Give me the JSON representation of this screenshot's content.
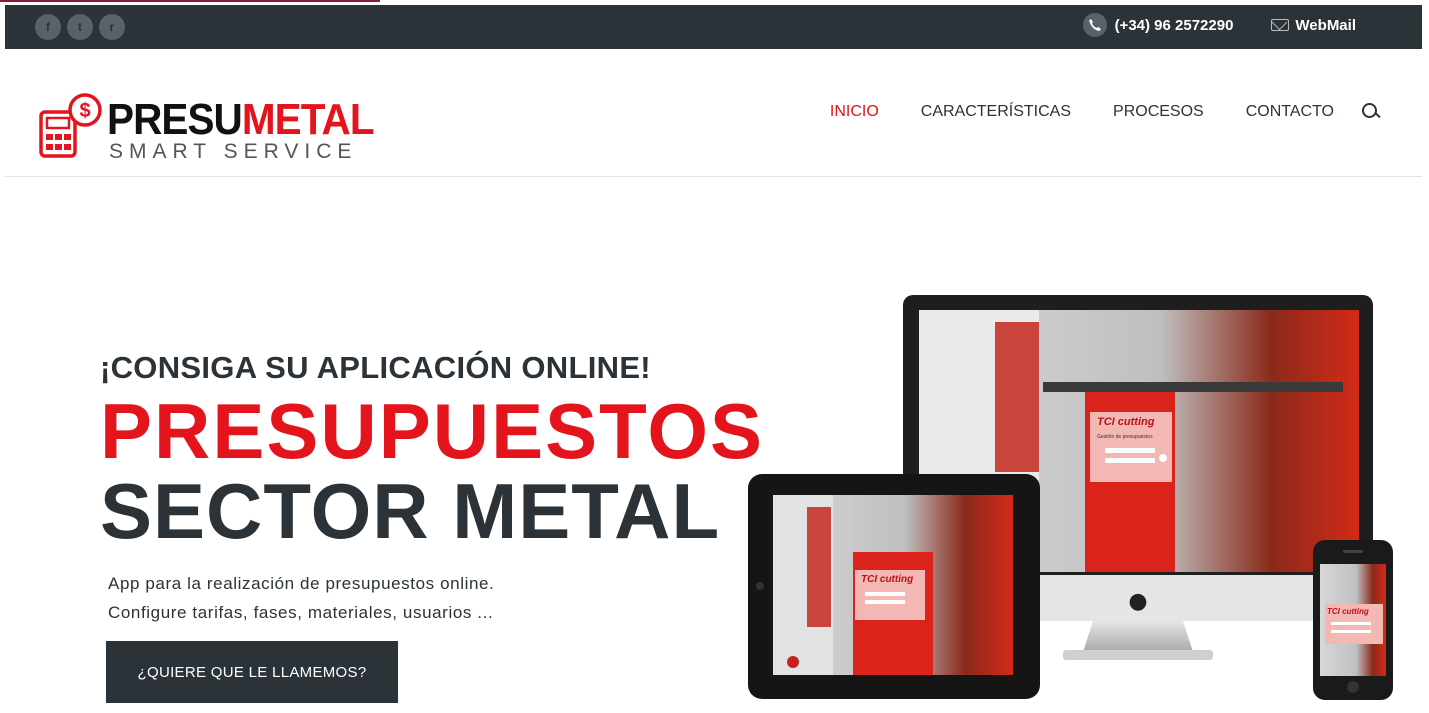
{
  "topbar": {
    "social": [
      {
        "icon": "facebook-icon",
        "glyph": "f"
      },
      {
        "icon": "twitter-icon",
        "glyph": "t"
      },
      {
        "icon": "rss-icon",
        "glyph": "r"
      }
    ],
    "phone": "(+34) 96 2572290",
    "webmail": "WebMail"
  },
  "logo": {
    "word_dark": "PRESU",
    "word_red": "METAL",
    "subtitle": "SMART SERVICE"
  },
  "nav": {
    "items": [
      {
        "label": "INICIO",
        "active": true
      },
      {
        "label": "CARACTERÍSTICAS",
        "active": false
      },
      {
        "label": "PROCESOS",
        "active": false
      },
      {
        "label": "CONTACTO",
        "active": false
      }
    ]
  },
  "hero": {
    "tagline": "¡CONSIGA SU APLICACIÓN ONLINE!",
    "title_line1": "PRESUPUESTOS",
    "title_line2": "SECTOR METAL",
    "desc_line1": "App para la realización de presupuestos online.",
    "desc_line2": "Configure tarifas, fases, materiales, usuarios ...",
    "cta": "¿QUIERE QUE LE LLAMEMOS?"
  },
  "screen": {
    "brand": "TCI cutting",
    "panel_title": "Gestión de presupuestos"
  },
  "colors": {
    "dark": "#2b3338",
    "red": "#e3141b"
  }
}
